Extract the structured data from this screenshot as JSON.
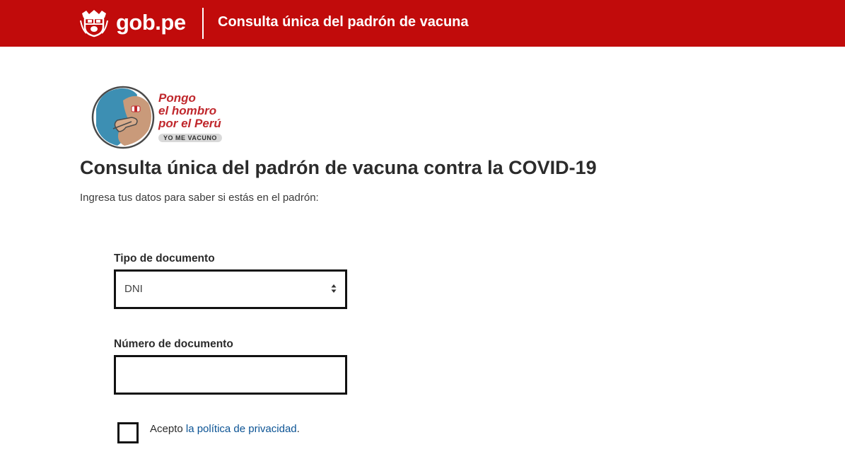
{
  "header": {
    "brand": "gob.pe",
    "title": "Consulta única del padrón de vacuna",
    "seal_icon": "peru-coat-of-arms-icon",
    "background_color": "#c10b0b"
  },
  "campaign": {
    "line1": "Pongo",
    "line2": "el hombro",
    "line3": "por el Perú",
    "badge": "YO ME VACUNO",
    "accent_color": "#c0282d"
  },
  "main": {
    "title": "Consulta única del padrón de vacuna contra la COVID-19",
    "subtitle": "Ingresa tus datos para saber si estás en el padrón:"
  },
  "form": {
    "document_type": {
      "label": "Tipo de documento",
      "value": "DNI",
      "icon": "select-arrows-icon"
    },
    "document_number": {
      "label": "Número de documento",
      "value": "",
      "placeholder": ""
    },
    "consent": {
      "checked": false,
      "prefix": "Acepto ",
      "link_text": "la política de privacidad",
      "suffix": ".",
      "link_color": "#0b5394"
    }
  }
}
